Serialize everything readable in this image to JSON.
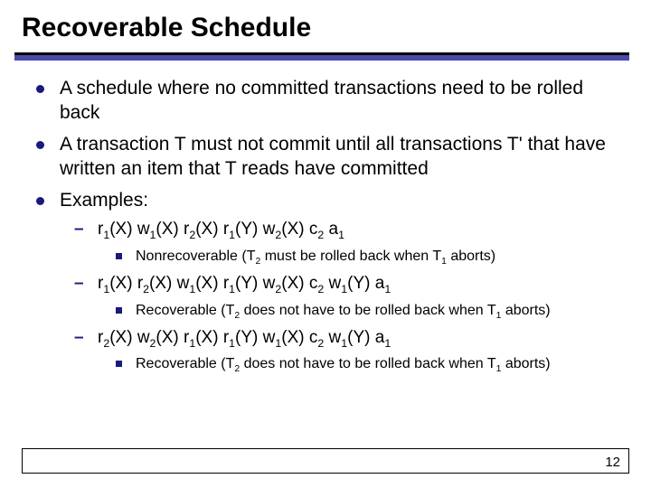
{
  "title": "Recoverable Schedule",
  "bullets": {
    "b1": "A schedule where no committed transactions need to be rolled back",
    "b2": "A transaction T must not commit until all transactions T' that have written an item that T reads have committed",
    "b3": "Examples:"
  },
  "examples": {
    "ex1": {
      "ops": [
        "r",
        "1",
        "(X) ",
        "w",
        "1",
        "(X) ",
        "r",
        "2",
        "(X) ",
        "r",
        "1",
        "(Y) ",
        "w",
        "2",
        "(X) ",
        "c",
        "2",
        " ",
        "a",
        "1"
      ],
      "note_pre": "Nonrecoverable (T",
      "note_sub1": "2",
      "note_mid": " must be rolled back when T",
      "note_sub2": "1",
      "note_post": " aborts)"
    },
    "ex2": {
      "ops": [
        "r",
        "1",
        "(X) ",
        "r",
        "2",
        "(X) ",
        "w",
        "1",
        "(X) ",
        "r",
        "1",
        "(Y) ",
        "w",
        "2",
        "(X) ",
        "c",
        "2",
        " ",
        "w",
        "1",
        "(Y) ",
        "a",
        "1"
      ],
      "note_pre": "Recoverable (T",
      "note_sub1": "2",
      "note_mid": " does not have to be rolled back when T",
      "note_sub2": "1",
      "note_post": " aborts)"
    },
    "ex3": {
      "ops": [
        "r",
        "2",
        "(X) ",
        "w",
        "2",
        "(X) ",
        "r",
        "1",
        "(X) ",
        "r",
        "1",
        "(Y) ",
        "w",
        "1",
        "(X) ",
        "c",
        "2",
        " ",
        "w",
        "1",
        "(Y) ",
        "a",
        "1"
      ],
      "note_pre": "Recoverable (T",
      "note_sub1": "2",
      "note_mid": " does not have to be rolled back when T",
      "note_sub2": "1",
      "note_post": " aborts)"
    }
  },
  "page_number": "12"
}
